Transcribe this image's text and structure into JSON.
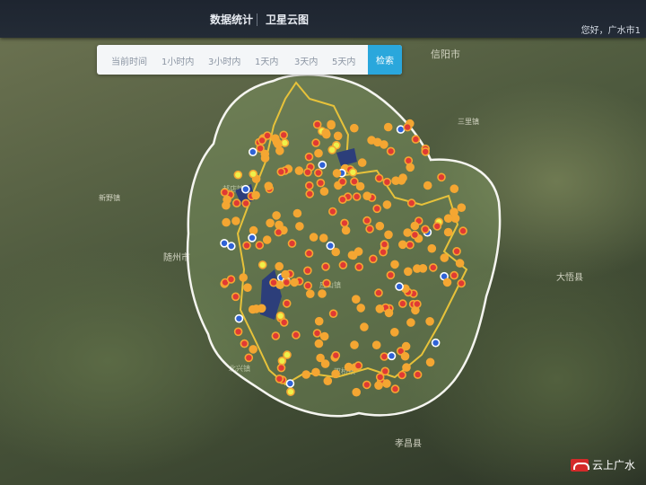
{
  "header": {
    "nav": [
      {
        "label": "数据统计"
      },
      {
        "label": "卫星云图"
      }
    ],
    "greeting": "您好，广水市1"
  },
  "filter": {
    "options": [
      {
        "label": "当前时间"
      },
      {
        "label": "1小时内"
      },
      {
        "label": "3小时内"
      },
      {
        "label": "1天内"
      },
      {
        "label": "3天内"
      },
      {
        "label": "5天内"
      }
    ],
    "search_label": "检索"
  },
  "map_labels": [
    {
      "text": "信阳市"
    },
    {
      "text": "随州市"
    },
    {
      "text": "大悟县"
    },
    {
      "text": "孝昌县"
    },
    {
      "text": "应山镇"
    },
    {
      "text": "新野镇"
    },
    {
      "text": "北兴镇"
    },
    {
      "text": "双桥镇"
    },
    {
      "text": "郝店镇"
    },
    {
      "text": "三里镇"
    }
  ],
  "marker_colors": {
    "red": "#e03a34",
    "blue": "#2f62d6",
    "orange": "#f4a632",
    "yellow": "#eef04a",
    "boundary": "#e7c23a"
  },
  "watermark": {
    "text": "云上广水"
  }
}
